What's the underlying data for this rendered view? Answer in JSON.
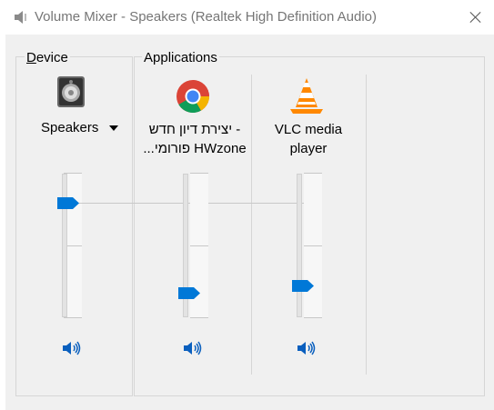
{
  "window": {
    "title": "Volume Mixer - Speakers (Realtek High Definition Audio)"
  },
  "device": {
    "group_label_prefix": "",
    "group_label_hotkey": "D",
    "group_label_rest": "evice",
    "name": "Speakers",
    "volume": 0.78,
    "muted": false
  },
  "applications": {
    "group_label": "Applications",
    "items": [
      {
        "name_line1": "- יצירת דיון חדש",
        "name_line2": "HWzone פורומי...",
        "icon": "chrome-icon",
        "volume": 0.17,
        "muted": false
      },
      {
        "name_line1": "VLC media",
        "name_line2": "player",
        "icon": "vlc-icon",
        "volume": 0.22,
        "muted": false
      }
    ]
  },
  "colors": {
    "accent": "#0078d7",
    "background": "#f0f0f0",
    "border": "#d6d6d6"
  }
}
